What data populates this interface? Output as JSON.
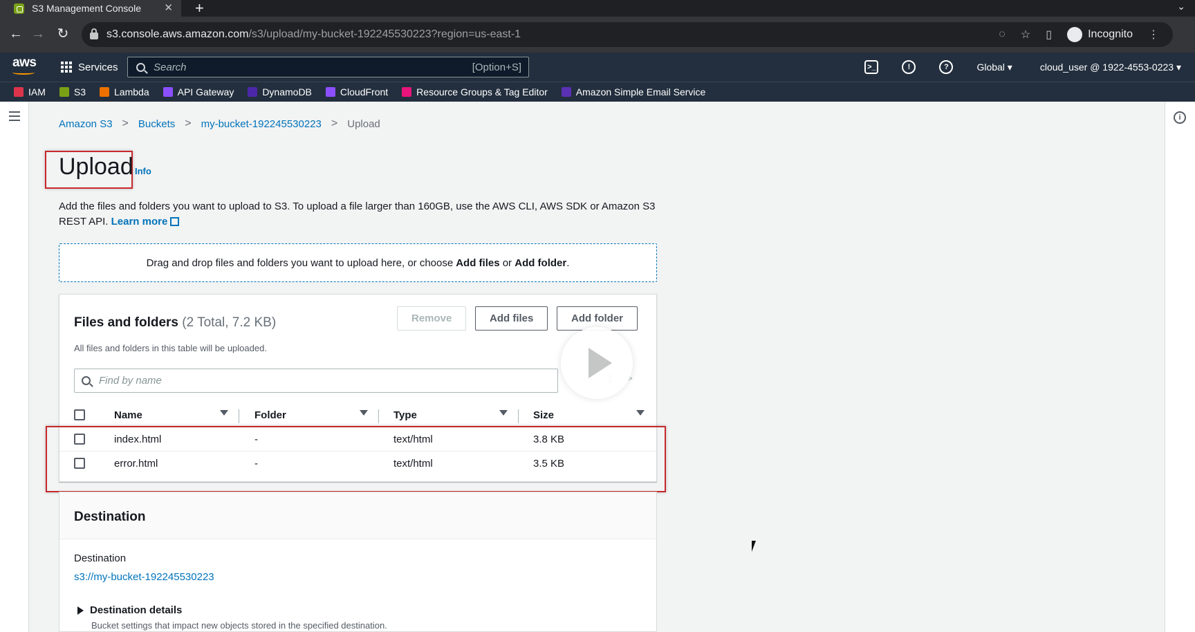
{
  "browser": {
    "tab_title": "S3 Management Console",
    "url_host": "s3.console.aws.amazon.com",
    "url_path": "/s3/upload/my-bucket-192245530223?region=us-east-1",
    "incognito_label": "Incognito"
  },
  "aws_nav": {
    "logo": "aws",
    "services_label": "Services",
    "search_placeholder": "Search",
    "search_shortcut": "[Option+S]",
    "region": "Global",
    "account": "cloud_user @ 1922-4553-0223"
  },
  "favorites": [
    {
      "label": "IAM",
      "color": "#dd344c"
    },
    {
      "label": "S3",
      "color": "#7aa116"
    },
    {
      "label": "Lambda",
      "color": "#ed7100"
    },
    {
      "label": "API Gateway",
      "color": "#8c4fff"
    },
    {
      "label": "DynamoDB",
      "color": "#4d27aa"
    },
    {
      "label": "CloudFront",
      "color": "#8c4fff"
    },
    {
      "label": "Resource Groups & Tag Editor",
      "color": "#e7157b"
    },
    {
      "label": "Amazon Simple Email Service",
      "color": "#5a30b5"
    }
  ],
  "breadcrumb": {
    "items": [
      "Amazon S3",
      "Buckets",
      "my-bucket-192245530223"
    ],
    "current": "Upload"
  },
  "page": {
    "title": "Upload",
    "info": "Info",
    "description": "Add the files and folders you want to upload to S3. To upload a file larger than 160GB, use the AWS CLI, AWS SDK or Amazon S3 REST API.",
    "learn_more": "Learn more",
    "dropzone_prefix": "Drag and drop files and folders you want to upload here, or choose ",
    "dropzone_add_files": "Add files",
    "dropzone_or": " or ",
    "dropzone_add_folder": "Add folder",
    "dropzone_suffix": "."
  },
  "files_panel": {
    "title": "Files and folders",
    "count": "(2 Total, 7.2 KB)",
    "subtitle": "All files and folders in this table will be uploaded.",
    "remove_label": "Remove",
    "add_files_label": "Add files",
    "add_folder_label": "Add folder",
    "find_placeholder": "Find by name",
    "page_number": "1",
    "columns": [
      "Name",
      "Folder",
      "Type",
      "Size"
    ],
    "rows": [
      {
        "name": "index.html",
        "folder": "-",
        "type": "text/html",
        "size": "3.8 KB"
      },
      {
        "name": "error.html",
        "folder": "-",
        "type": "text/html",
        "size": "3.5 KB"
      }
    ]
  },
  "destination": {
    "heading": "Destination",
    "label": "Destination",
    "value": "s3://my-bucket-192245530223",
    "details_label": "Destination details",
    "details_sub": "Bucket settings that impact new objects stored in the specified destination."
  }
}
